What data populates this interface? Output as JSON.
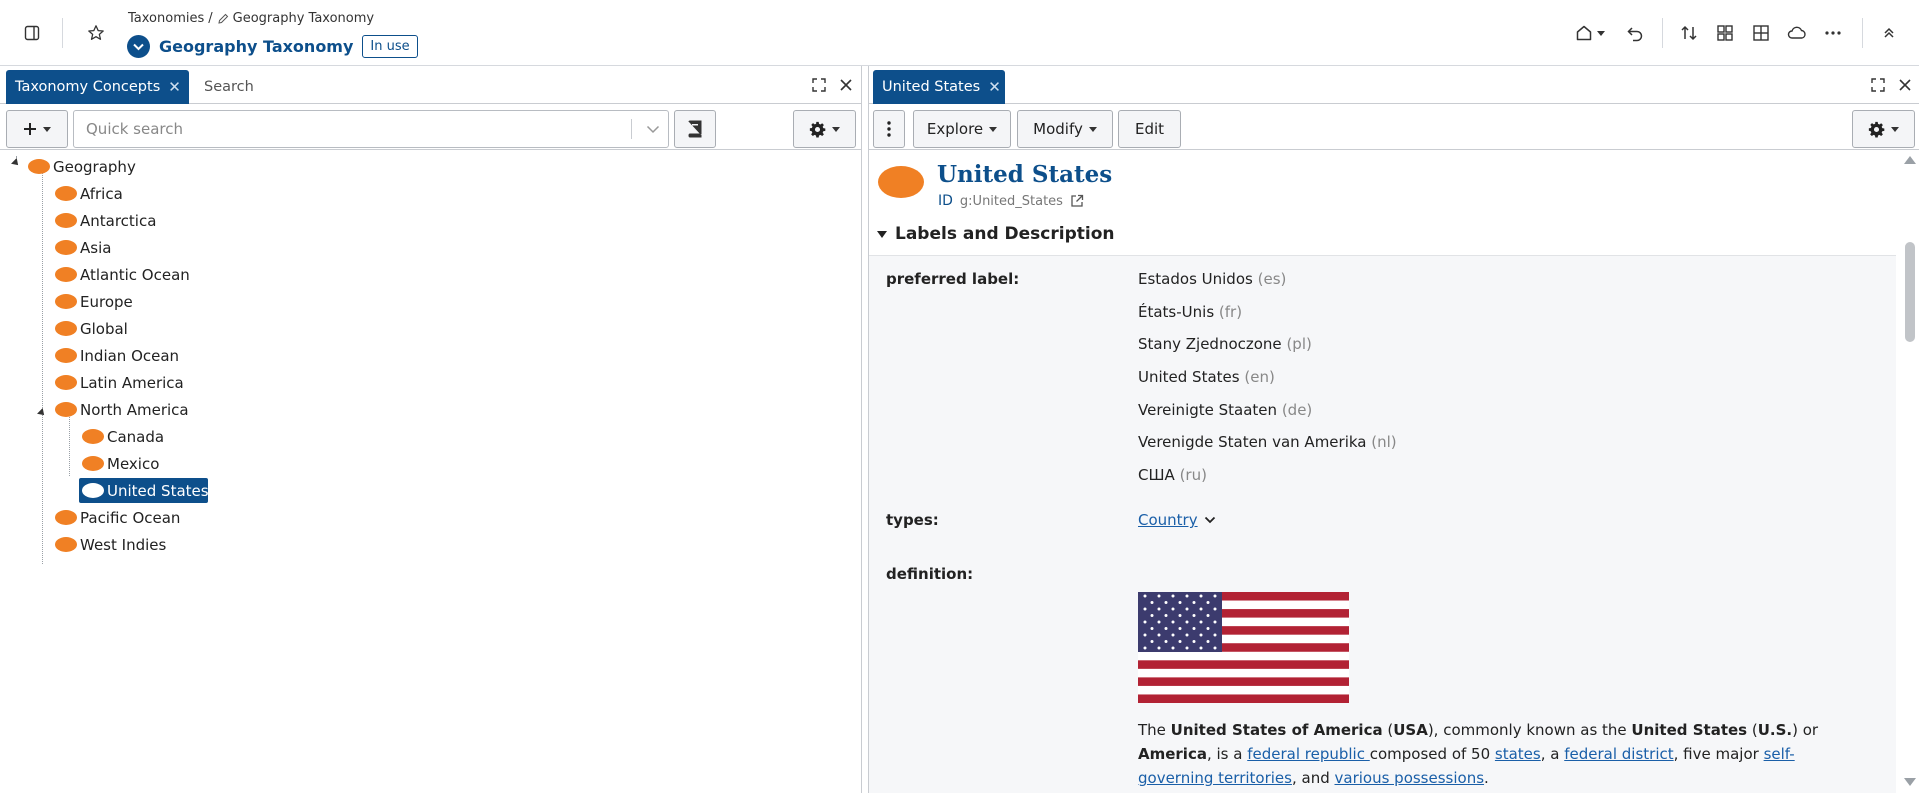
{
  "app": {
    "breadcrumb": {
      "parent": "Taxonomies",
      "separator": "/",
      "current": "Geography Taxonomy"
    },
    "title": "Geography Taxonomy",
    "status_badge": "In use",
    "icons": [
      "sidebar-toggle-icon",
      "star-icon",
      "home-icon",
      "undo-icon",
      "sort-icon",
      "dashboard-icon",
      "add-panel-icon",
      "cloud-icon",
      "more-icon",
      "collapse-up-icon"
    ]
  },
  "left_panel": {
    "tabs": [
      {
        "label": "Taxonomy Concepts",
        "active": true
      },
      {
        "label": "Search",
        "active": false
      }
    ],
    "quick_search_placeholder": "Quick search",
    "tree": {
      "root": "Geography",
      "children": [
        {
          "label": "Africa"
        },
        {
          "label": "Antarctica"
        },
        {
          "label": "Asia"
        },
        {
          "label": "Atlantic Ocean"
        },
        {
          "label": "Europe"
        },
        {
          "label": "Global"
        },
        {
          "label": "Indian Ocean"
        },
        {
          "label": "Latin America"
        },
        {
          "label": "North America",
          "expanded": true,
          "children": [
            {
              "label": "Canada"
            },
            {
              "label": "Mexico"
            },
            {
              "label": "United States",
              "selected": true
            }
          ]
        },
        {
          "label": "Pacific Ocean"
        },
        {
          "label": "West Indies"
        }
      ]
    }
  },
  "right_panel": {
    "tab_label": "United States",
    "toolbar": {
      "explore": "Explore",
      "modify": "Modify",
      "edit": "Edit"
    },
    "concept": {
      "title": "United States",
      "id_label": "ID",
      "id_value": "g:United_States"
    },
    "section_title": "Labels and Description",
    "properties": {
      "preferred_label_name": "preferred label:",
      "preferred_labels": [
        {
          "text": "Estados Unidos",
          "lang": "(es)"
        },
        {
          "text": "États-Unis",
          "lang": "(fr)"
        },
        {
          "text": "Stany Zjednoczone",
          "lang": "(pl)"
        },
        {
          "text": "United States",
          "lang": "(en)"
        },
        {
          "text": "Vereinigte Staaten",
          "lang": "(de)"
        },
        {
          "text": "Verenigde Staten van Amerika",
          "lang": "(nl)"
        },
        {
          "text": "США",
          "lang": "(ru)"
        }
      ],
      "types_name": "types:",
      "types_value": "Country",
      "definition_name": "definition:"
    },
    "description": {
      "t1": "The ",
      "b1": "United States of America",
      "t2": " (",
      "b2": "USA",
      "t3": "), commonly known as the ",
      "b3": "United States",
      "t4": " (",
      "b4": "U.S.",
      "t5": ") or ",
      "b5": "America",
      "t6": ", is a ",
      "l1": "federal republic ",
      "t7": "composed of 50 ",
      "l2": "states",
      "t8": ", a ",
      "l3": "federal district",
      "t9": ", five major ",
      "l4": "self-governing territories",
      "t10": ", and ",
      "l5": "various possessions",
      "t11": "."
    },
    "colors": {
      "brand": "#0d4f8b",
      "concept": "#f08024",
      "flag_red": "#b22234",
      "flag_blue": "#3c3b6e"
    }
  }
}
